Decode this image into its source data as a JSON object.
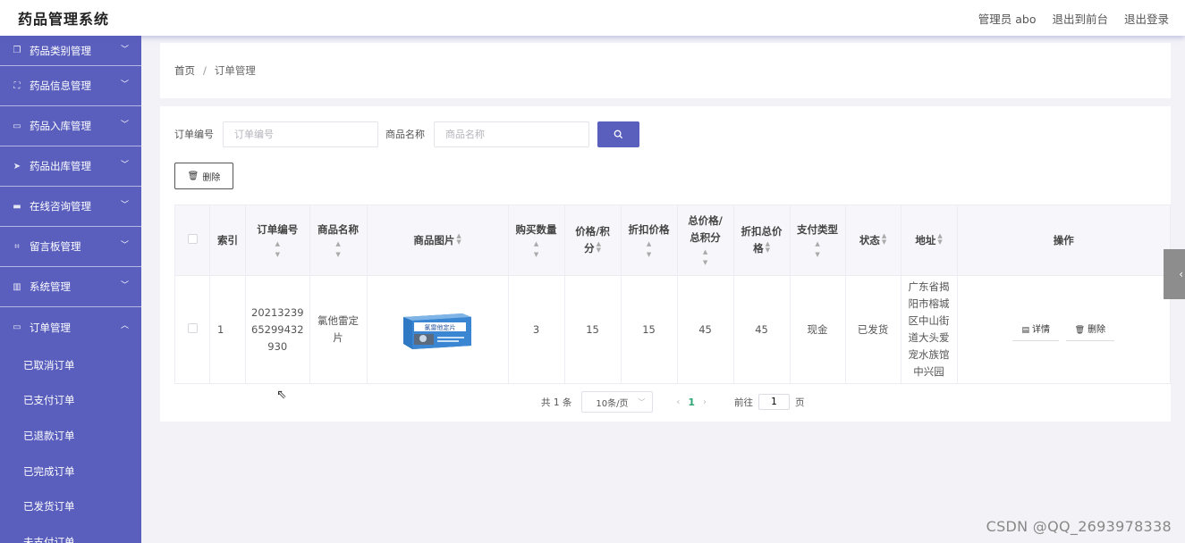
{
  "header": {
    "app_title": "药品管理系统",
    "admin_label": "管理员 abo",
    "to_front": "退出到前台",
    "logout": "退出登录"
  },
  "sidebar": {
    "items": [
      {
        "label": "药品类别管理",
        "icon": "copy-icon"
      },
      {
        "label": "药品信息管理",
        "icon": "scan-icon"
      },
      {
        "label": "药品入库管理",
        "icon": "message-icon"
      },
      {
        "label": "药品出库管理",
        "icon": "send-icon"
      },
      {
        "label": "在线咨询管理",
        "icon": "chat-icon"
      },
      {
        "label": "留言板管理",
        "icon": "crop-icon"
      },
      {
        "label": "系统管理",
        "icon": "chart-icon"
      },
      {
        "label": "订单管理",
        "icon": "comment-icon"
      }
    ],
    "sub_items": [
      "已取消订单",
      "已支付订单",
      "已退款订单",
      "已完成订单",
      "已发货订单",
      "未支付订单"
    ]
  },
  "breadcrumb": {
    "home": "首页",
    "separator": "/",
    "current": "订单管理"
  },
  "search": {
    "order_label": "订单编号",
    "order_placeholder": "订单编号",
    "product_label": "商品名称",
    "product_placeholder": "商品名称"
  },
  "toolbar": {
    "delete_label": "删除"
  },
  "table": {
    "headers": {
      "index": "索引",
      "order_no_1": "订单编号",
      "product_name_1": "商品名称",
      "product_image": "商品图片",
      "quantity": "购买数量",
      "price_1": "价格/积",
      "price_2": "分",
      "discount_price": "折扣价格",
      "total_1": "总价格/",
      "total_2": "总积分",
      "discount_total_1": "折扣总价",
      "discount_total_2": "格",
      "pay_type": "支付类型",
      "status": "状态",
      "address": "地址",
      "actions": "操作"
    },
    "rows": [
      {
        "index": "1",
        "order_no": [
          "20213239",
          "65299432",
          "930"
        ],
        "product_name": [
          "氯他雷定",
          "片"
        ],
        "image_text": "氯雷他定片",
        "quantity": "3",
        "price": "15",
        "discount_price": "15",
        "total": "45",
        "discount_total": "45",
        "pay_type": "现金",
        "status": "已发货",
        "address": [
          "广东省揭",
          "阳市榕城",
          "区中山街",
          "道大头爱",
          "宠水族馆",
          "中兴园"
        ],
        "detail_label": "详情",
        "delete_label": "删除"
      }
    ]
  },
  "pagination": {
    "total_text": "共 1 条",
    "page_size": "10条/页",
    "current_page": "1",
    "goto_label": "前往",
    "goto_value": "1",
    "page_suffix": "页"
  },
  "watermark": "CSDN @QQ_2693978338",
  "colors": {
    "sidebar_bg": "#5a5fbe",
    "accent": "#5a5fbe",
    "page_active": "#2ba673"
  }
}
